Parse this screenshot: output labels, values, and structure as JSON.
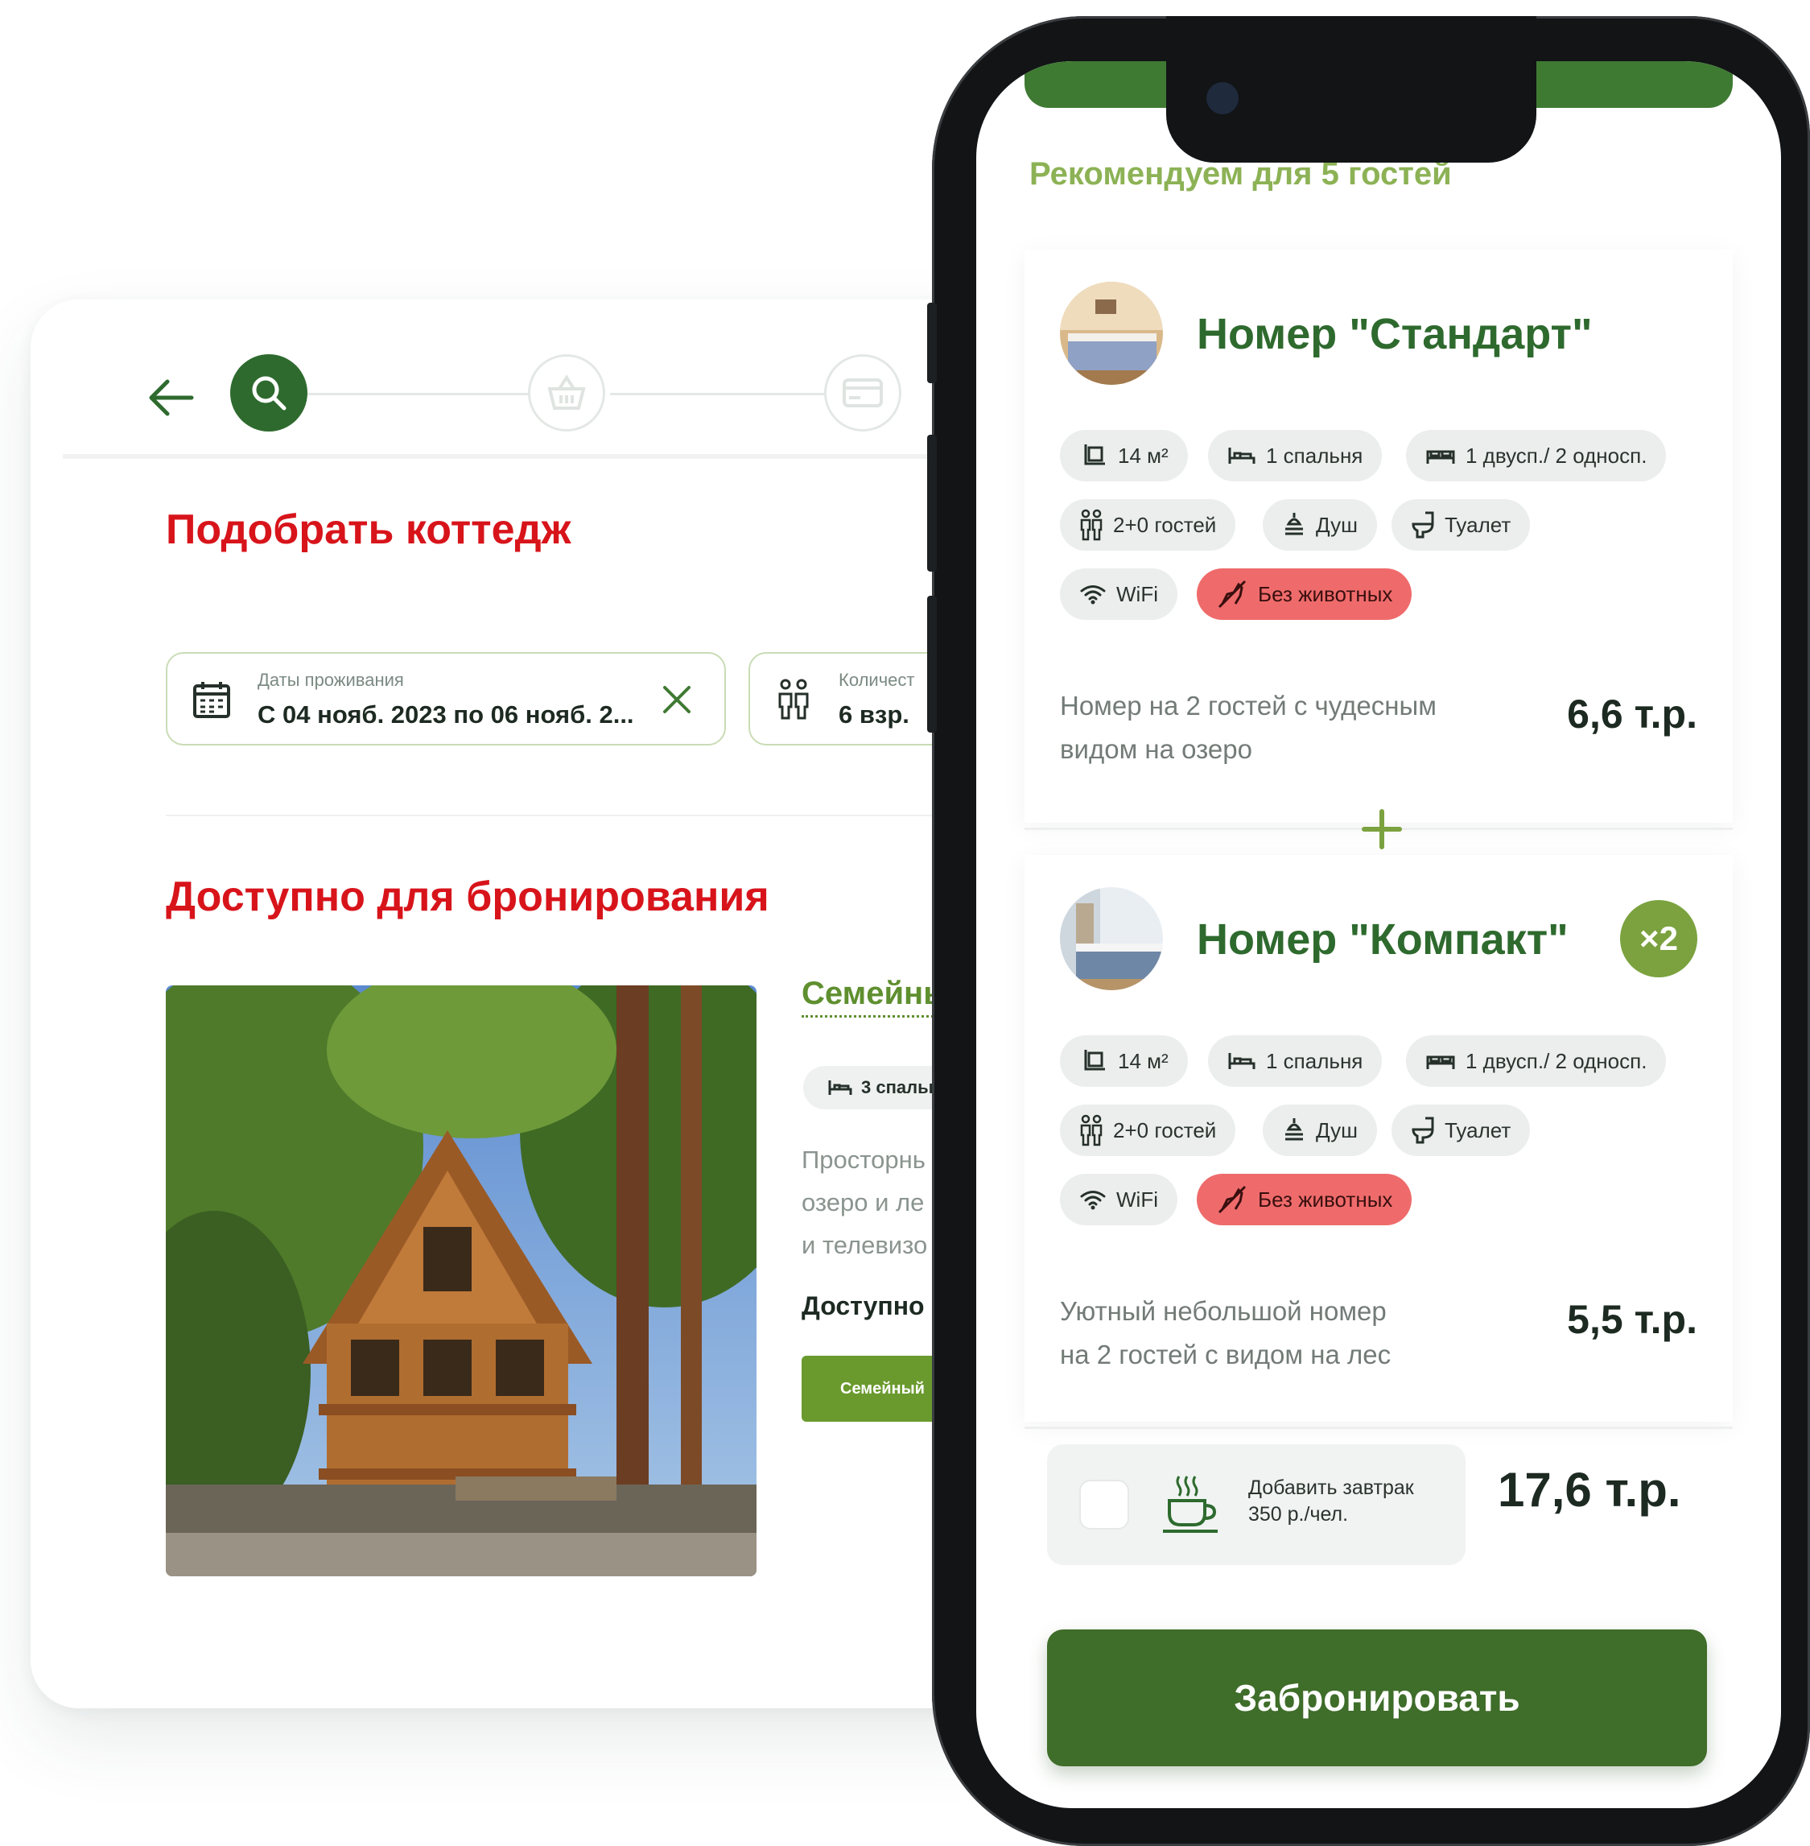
{
  "desktop": {
    "title": "Подобрать коттедж",
    "dates_field": {
      "label": "Даты проживания",
      "value": "С 04 нояб. 2023 по 06 нояб. 2..."
    },
    "guests_field": {
      "label": "Количест",
      "value": "6 взр."
    },
    "available_title": "Доступно для бронирования",
    "cottage": {
      "name": "Семейнь",
      "bedrooms_chip": "3 спальн",
      "description": "Просторнь\nозеро и ле\nи телевизо",
      "availability": "Доступно",
      "button_label": "Семейный"
    },
    "stepper": {
      "steps": [
        "search-icon",
        "basket-icon",
        "card-icon"
      ],
      "active_step": 1
    }
  },
  "phone": {
    "recommend_title": "Рекомендуем для 5 гостей",
    "rooms": [
      {
        "title": "Номер \"Стандарт\"",
        "multiplier": "",
        "chips": {
          "area": "14 м²",
          "bedrooms": "1 спальня",
          "beds": "1 двусп./ 2 односп.",
          "guests": "2+0 гостей",
          "shower": "Душ",
          "toilet": "Туалет",
          "wifi": "WiFi",
          "no_pets": "Без животных"
        },
        "description": "Номер на 2 гостей с чудесным\nвидом на озеро",
        "price": "6,6 т.р."
      },
      {
        "title": "Номер \"Компакт\"",
        "multiplier": "×2",
        "chips": {
          "area": "14 м²",
          "bedrooms": "1 спальня",
          "beds": "1 двусп./ 2 односп.",
          "guests": "2+0 гостей",
          "shower": "Душ",
          "toilet": "Туалет",
          "wifi": "WiFi",
          "no_pets": "Без животных"
        },
        "description": "Уютный небольшой номер\nна 2 гостей с видом на лес",
        "price": "5,5 т.р."
      }
    ],
    "breakfast": {
      "label": "Добавить завтрак\n350 р./чел.",
      "checked": false
    },
    "total_price": "17,6 т.р.",
    "book_button": "Забронировать",
    "colors": {
      "primary_green": "#2e6a2e",
      "accent_green": "#7ba23f",
      "heading_red": "#d8141b",
      "no_pets_red": "#ef6b6b"
    }
  }
}
